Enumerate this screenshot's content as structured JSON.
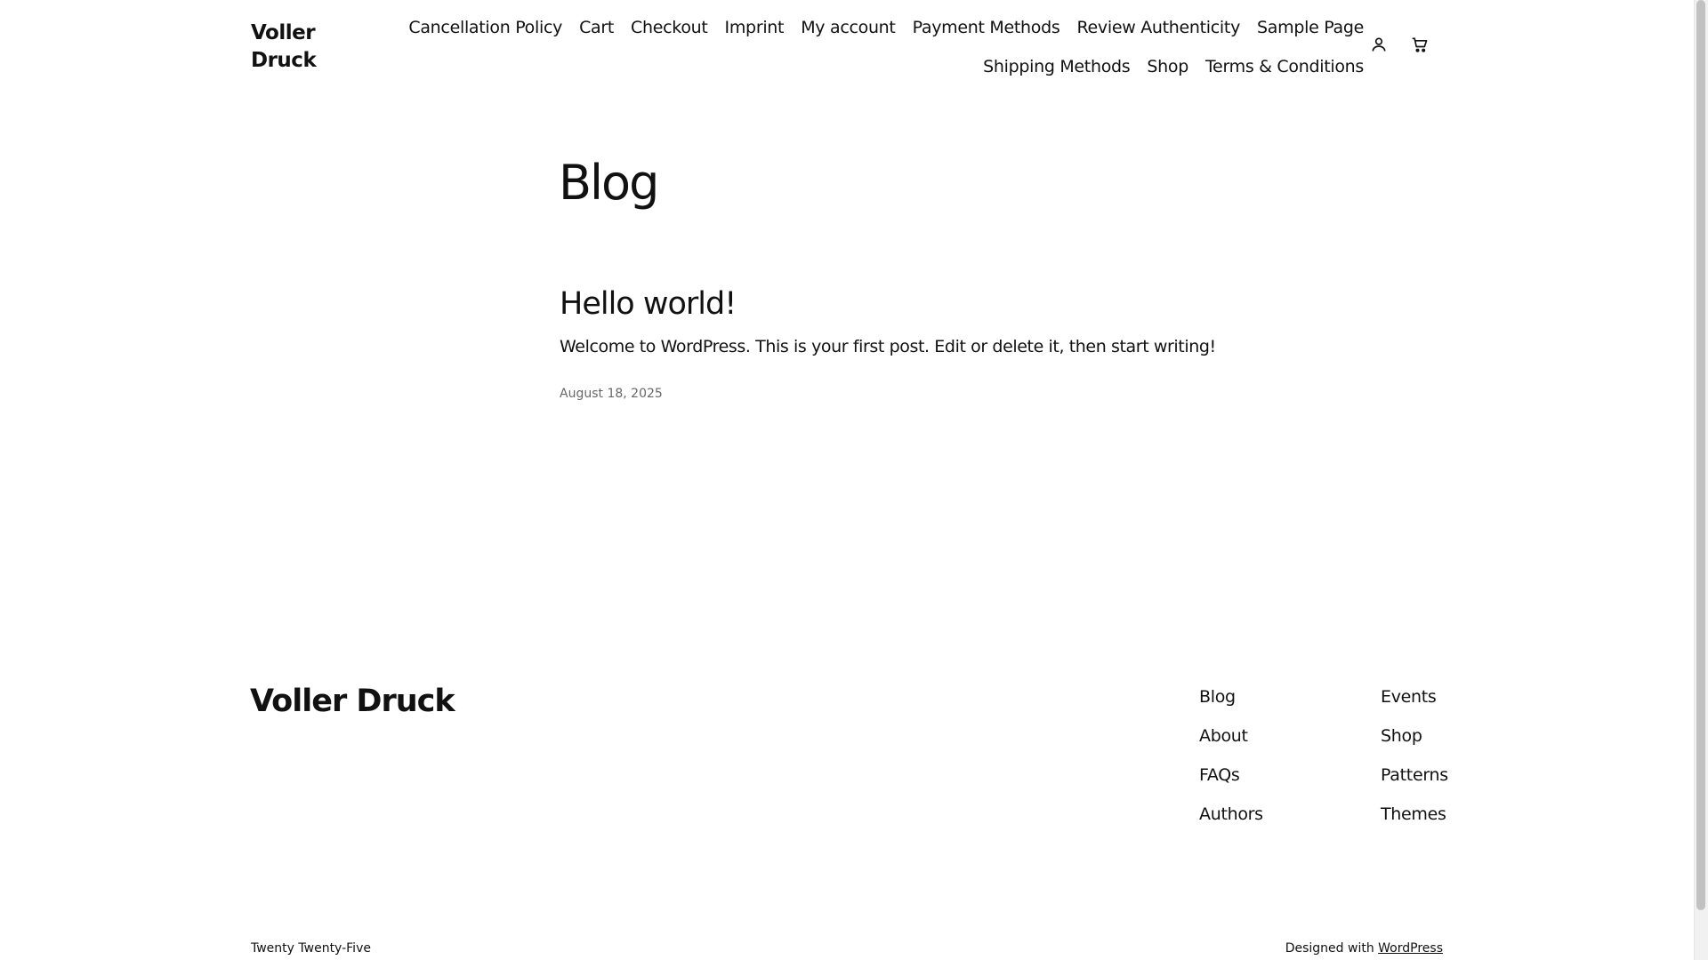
{
  "header": {
    "site_title": "Voller Druck",
    "nav": [
      "Cancellation Policy",
      "Cart",
      "Checkout",
      "Imprint",
      "My account",
      "Payment Methods",
      "Review Authenticity",
      "Sample Page",
      "Shipping Methods",
      "Shop",
      "Terms & Conditions"
    ],
    "icons": [
      "account-icon",
      "cart-icon"
    ]
  },
  "main": {
    "heading": "Blog",
    "posts": [
      {
        "title": "Hello world!",
        "excerpt": "Welcome to WordPress. This is your first post. Edit or delete it, then start writing!",
        "date": "August 18, 2025"
      }
    ]
  },
  "footer": {
    "site_title": "Voller Druck",
    "col1": [
      "Blog",
      "About",
      "FAQs",
      "Authors"
    ],
    "col2": [
      "Events",
      "Shop",
      "Patterns",
      "Themes"
    ],
    "theme_name": "Twenty Twenty-Five",
    "credit_prefix": "Designed with",
    "credit_link": "WordPress"
  },
  "colors": {
    "text": "#111111",
    "muted": "#686868",
    "background": "#ffffff"
  }
}
